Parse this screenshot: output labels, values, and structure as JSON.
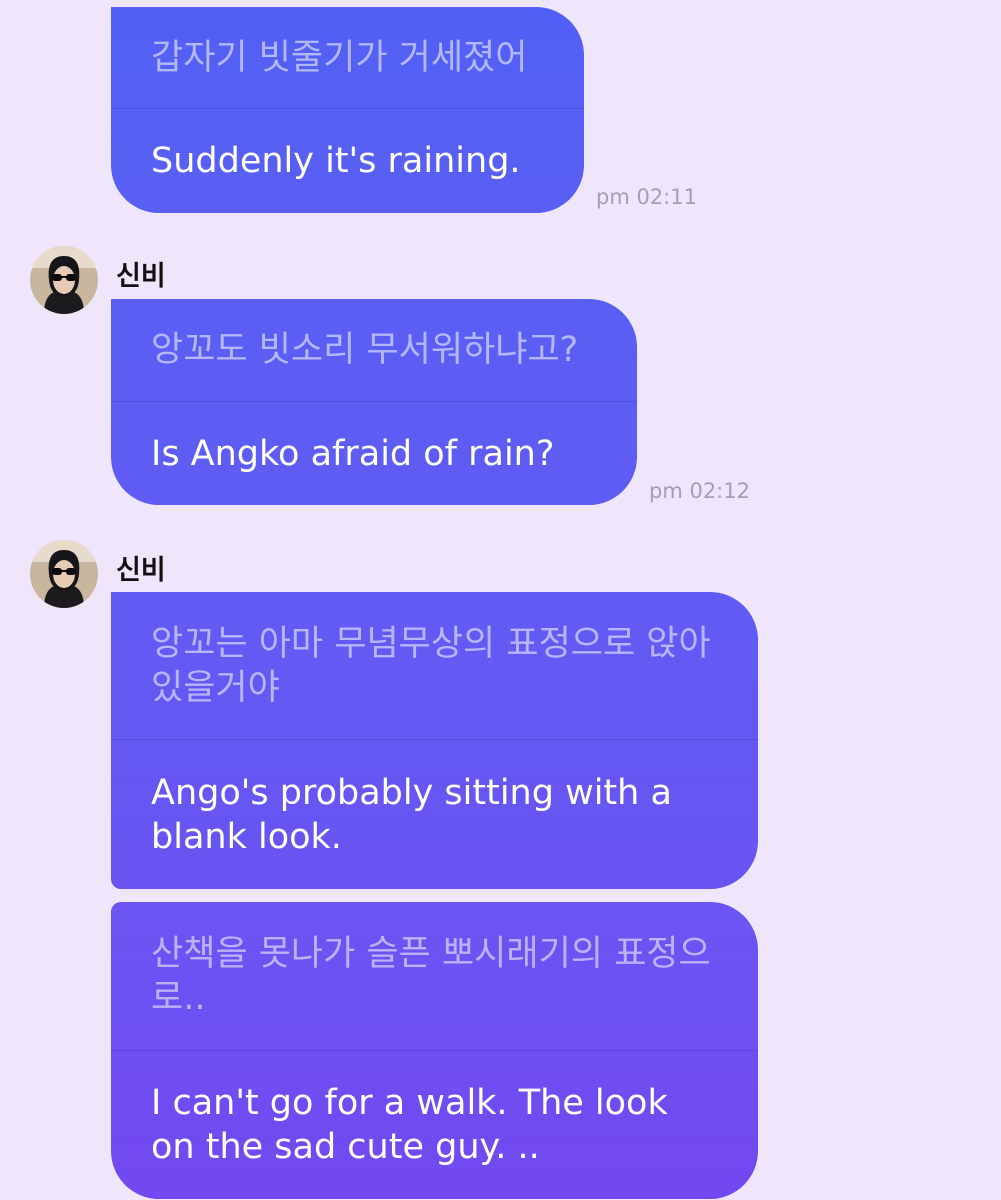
{
  "colors": {
    "background": "#efe6fb",
    "bubble_top": "#5660f3",
    "bubble_bottom": "#7248f0",
    "timestamp": "#a49fb4"
  },
  "messages": [
    {
      "korean": "갑자기 빗줄기가 거세졌어",
      "english": "Suddenly it's raining.",
      "time": "pm 02:11"
    },
    {
      "sender": "신비",
      "avatar_icon": "profile-photo-sunglasses",
      "korean": "앙꼬도 빗소리 무서워하냐고?",
      "english": "Is Angko afraid of rain?",
      "time": "pm 02:12"
    },
    {
      "sender": "신비",
      "avatar_icon": "profile-photo-sunglasses",
      "korean": "앙꼬는 아마 무념무상의 표정으로 앉아있을거야",
      "english": "Ango's probably sitting with a blank look."
    },
    {
      "korean": "산책을 못나가 슬픈 뽀시래기의 표정으로..",
      "english": "I can't go for a walk. The look on the sad cute guy. .."
    }
  ]
}
